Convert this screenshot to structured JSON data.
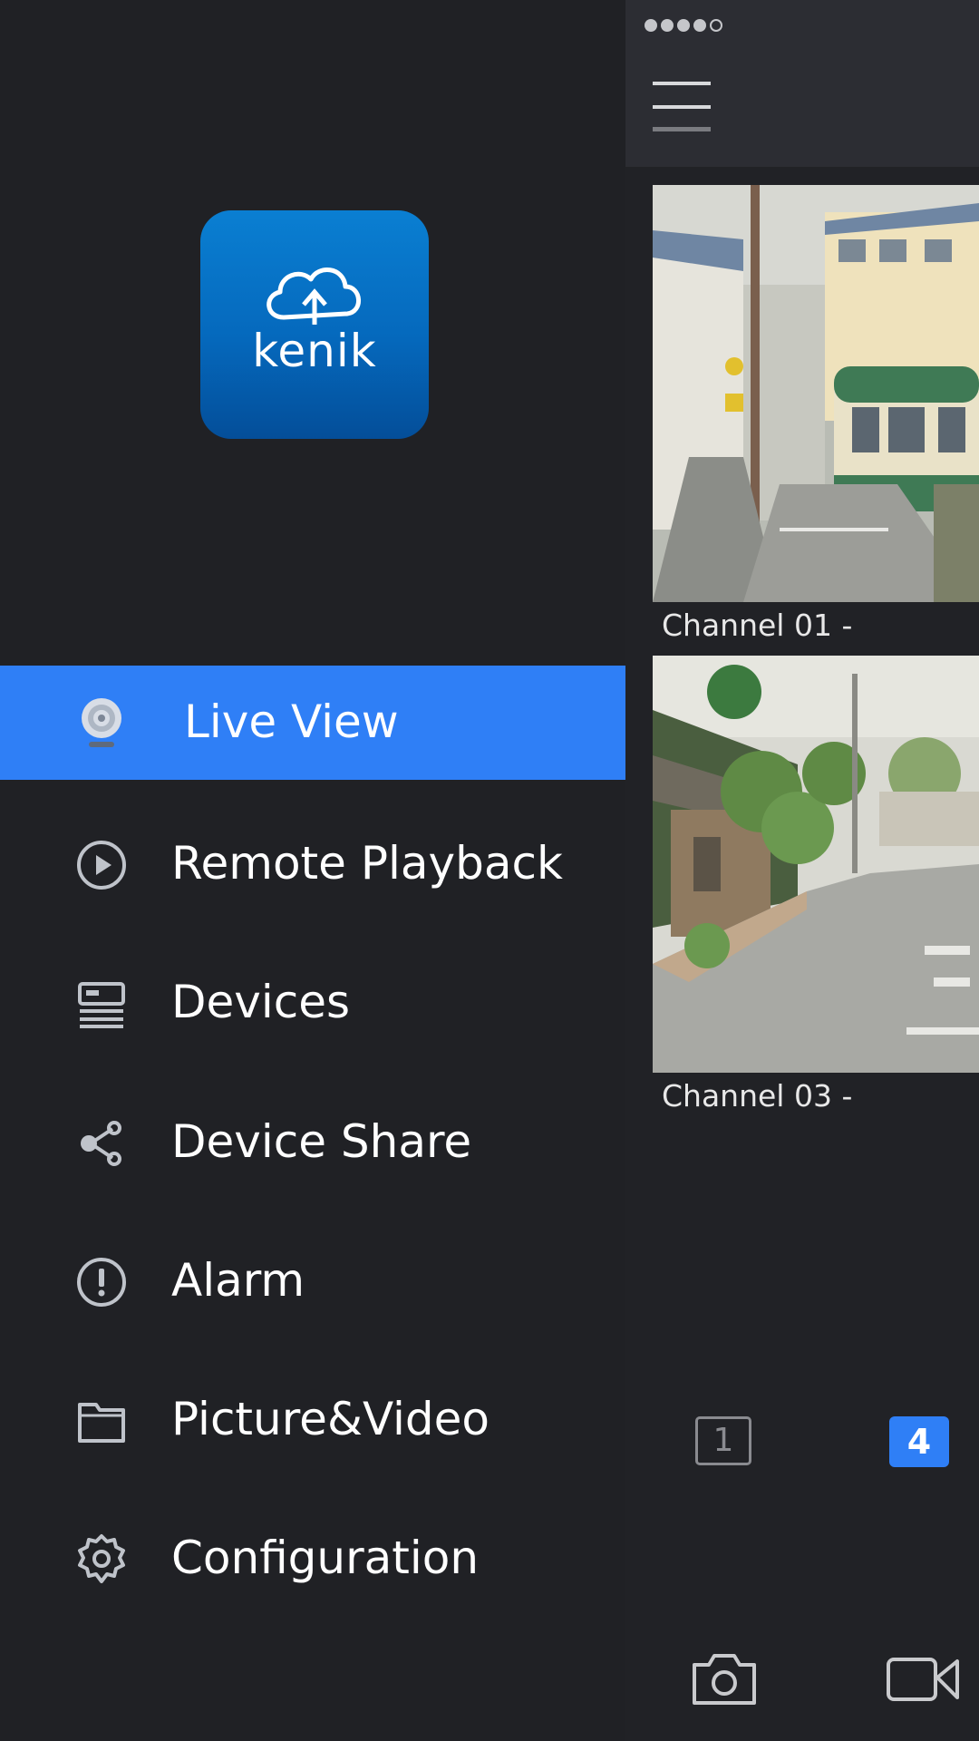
{
  "logo": {
    "text": "kenik",
    "icon": "cloud-upload-icon"
  },
  "menu": [
    {
      "label": "Live View",
      "icon": "camera-icon",
      "active": true
    },
    {
      "label": "Remote Playback",
      "icon": "play-circle-icon",
      "active": false
    },
    {
      "label": "Devices",
      "icon": "dvr-device-icon",
      "active": false
    },
    {
      "label": "Device Share",
      "icon": "share-icon",
      "active": false
    },
    {
      "label": "Alarm",
      "icon": "alert-circle-icon",
      "active": false
    },
    {
      "label": "Picture&Video",
      "icon": "folder-icon",
      "active": false
    },
    {
      "label": "Configuration",
      "icon": "gear-icon",
      "active": false
    }
  ],
  "channels": [
    {
      "name": "Channel 01 -"
    },
    {
      "name": "Channel 03 -"
    }
  ],
  "layout_buttons": {
    "single": "1",
    "quad": "4",
    "selected": "4"
  },
  "toolbar": {
    "snapshot_icon": "camera-snapshot-icon",
    "record_icon": "video-record-icon"
  },
  "colors": {
    "accent": "#2f7ff6",
    "background": "#202125",
    "panel_header": "#2c2d33"
  }
}
